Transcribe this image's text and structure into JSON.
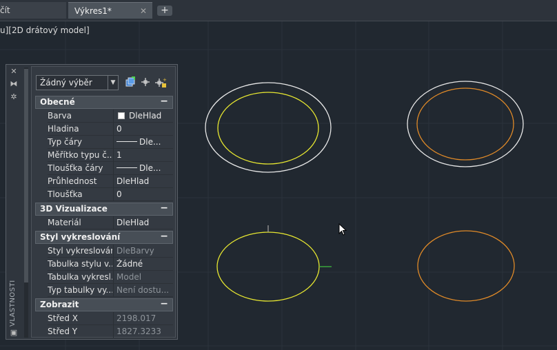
{
  "tabs": {
    "prev_label": "čít",
    "active_label": "Výkres1*",
    "close_glyph": "✕",
    "add_glyph": "+"
  },
  "viewport": {
    "label": "u][2D drátový model]"
  },
  "colors": {
    "background": "#212830",
    "grid": "#2a323b",
    "white_ellipse": "#e8e8e8",
    "yellow_ellipse": "#e8e830",
    "orange_ellipse": "#e08a28",
    "grip_green": "#3fbf3f"
  },
  "palette": {
    "side_title": "VLASTNOSTI",
    "side_buttons": [
      "close-icon",
      "pin-icon",
      "gear-icon"
    ],
    "selection": "Žádný výběr",
    "tool_icons": [
      "quick-select-icon",
      "select-objects-icon",
      "toggle-pickadd-icon"
    ],
    "sections": [
      {
        "title": "Obecné",
        "collapse": "−",
        "rows": [
          {
            "key": "Barva",
            "value": "DleHlad",
            "swatch": true
          },
          {
            "key": "Hladina",
            "value": "0"
          },
          {
            "key": "Typ čáry",
            "value": "Dle...",
            "line": true
          },
          {
            "key": "Měřítko typu č...",
            "value": "1"
          },
          {
            "key": "Tloušťka čáry",
            "value": "Dle...",
            "line": true
          },
          {
            "key": "Průhlednost",
            "value": "DleHlad"
          },
          {
            "key": "Tloušťka",
            "value": "0"
          }
        ]
      },
      {
        "title": "3D Vizualizace",
        "collapse": "−",
        "rows": [
          {
            "key": "Materiál",
            "value": "DleHlad"
          }
        ]
      },
      {
        "title": "Styl vykreslování",
        "collapse": "−",
        "rows": [
          {
            "key": "Styl vykreslování",
            "value": "DleBarvy",
            "dim": true
          },
          {
            "key": "Tabulka stylu v...",
            "value": "Žádné"
          },
          {
            "key": "Tabulka vykresl...",
            "value": "Model",
            "dim": true
          },
          {
            "key": "Typ tabulky vy...",
            "value": "Není dostu...",
            "dim": true
          }
        ]
      },
      {
        "title": "Zobrazit",
        "collapse": "−",
        "rows": [
          {
            "key": "Střed X",
            "value": "2198.017",
            "dim": true
          },
          {
            "key": "Střed Y",
            "value": "1827.3233",
            "dim": true
          }
        ]
      }
    ]
  }
}
